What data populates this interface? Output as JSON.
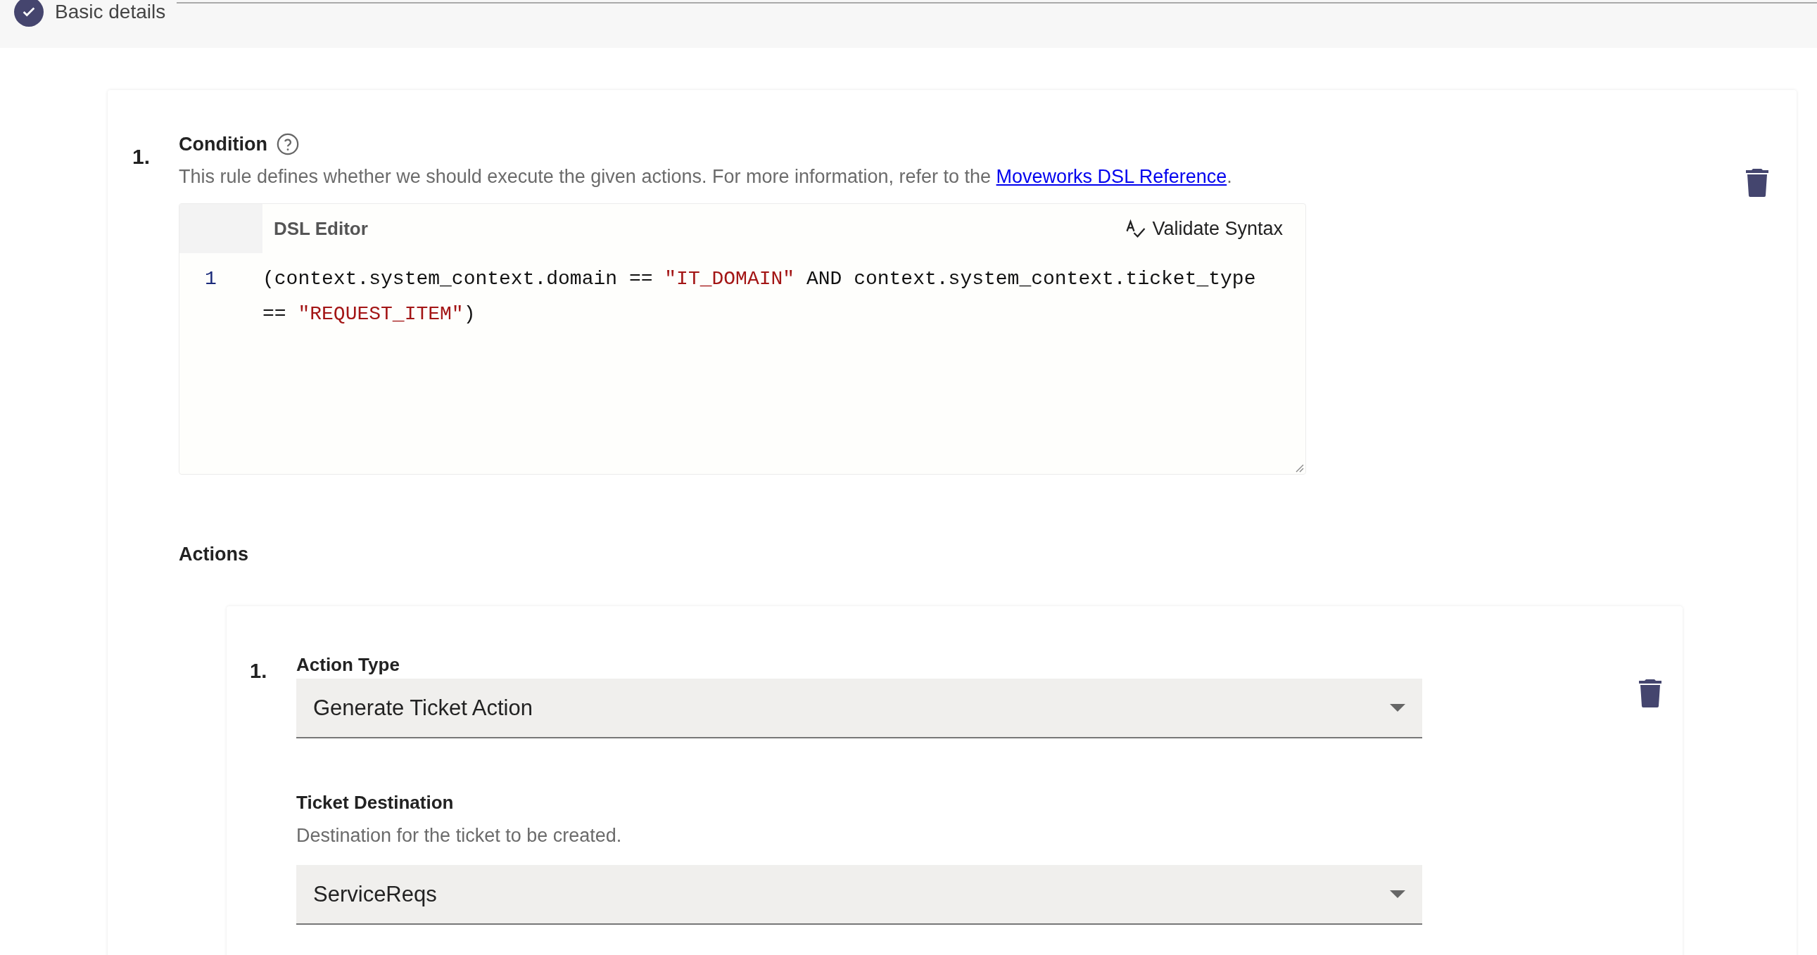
{
  "step": {
    "label": "Basic details",
    "completed": true
  },
  "rule": {
    "number": "1.",
    "title": "Condition",
    "description": "This rule defines whether we should execute the given actions. For more information, refer to the ",
    "link": "Moveworks DSL Reference",
    "description_end": ".",
    "editor": {
      "title": "DSL Editor",
      "validate_label": "Validate Syntax",
      "lines": [
        {
          "number": "1",
          "tokens": [
            {
              "text": "(context.system_context.domain == ",
              "kind": "plain"
            },
            {
              "text": "\"IT_DOMAIN\"",
              "kind": "string"
            },
            {
              "text": " AND context.system_context.ticket_type == ",
              "kind": "plain"
            },
            {
              "text": "\"REQUEST_ITEM\"",
              "kind": "string"
            },
            {
              "text": ")",
              "kind": "plain"
            }
          ]
        }
      ]
    },
    "actions_label": "Actions",
    "actions": [
      {
        "number": "1.",
        "fields": [
          {
            "label": "Action Type",
            "value": "Generate Ticket Action"
          },
          {
            "label": "Ticket Destination",
            "description": "Destination for the ticket to be created.",
            "value": "ServiceReqs"
          }
        ]
      }
    ]
  }
}
